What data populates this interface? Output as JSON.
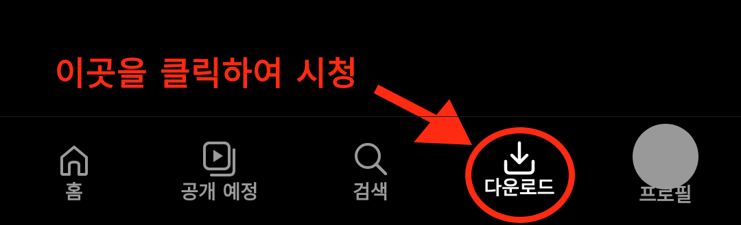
{
  "annotation": {
    "text": "이곳을 클릭하여 시청",
    "color": "#ff2a12"
  },
  "nav": {
    "items": [
      {
        "label": "홈",
        "icon": "home-icon",
        "active": false
      },
      {
        "label": "공개 예정",
        "icon": "upcoming-icon",
        "active": false
      },
      {
        "label": "검색",
        "icon": "search-icon",
        "active": false
      },
      {
        "label": "다운로드",
        "icon": "download-icon",
        "active": true
      },
      {
        "label": "프로필",
        "icon": "avatar",
        "active": false
      }
    ],
    "active_color": "#ffffff",
    "inactive_color": "#9a9a9a"
  }
}
